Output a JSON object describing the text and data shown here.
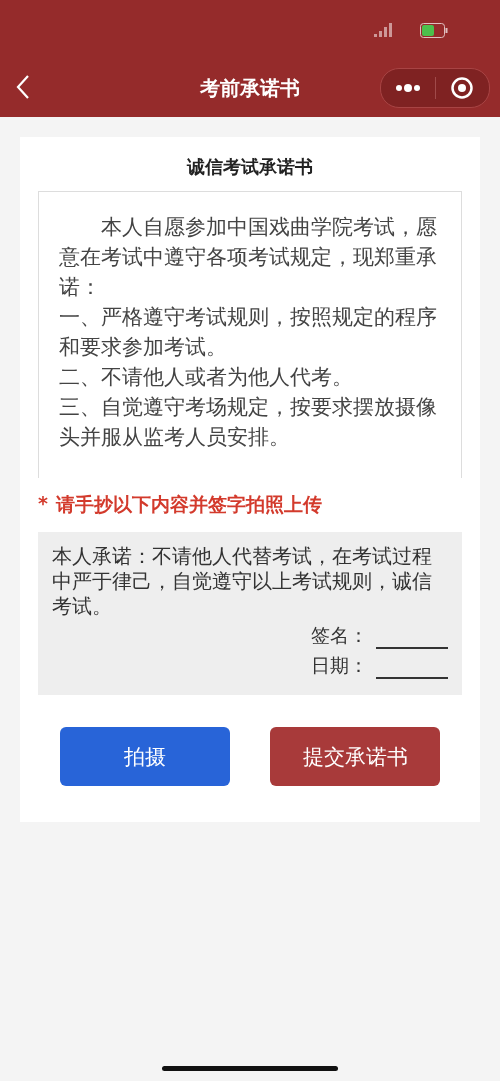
{
  "nav_bar": {
    "title": "考前承诺书"
  },
  "letter": {
    "title": "诚信考试承诺书",
    "paragraphs": [
      {
        "text": "本人自愿参加中国戏曲学院考试，愿意在考试中遵守各项考试规定，现郑重承诺：",
        "indent": true
      },
      {
        "text": "一、严格遵守考试规则，按照规定的程序和要求参加考试。",
        "indent": false
      },
      {
        "text": "二、不请他人或者为他人代考。",
        "indent": false
      },
      {
        "text": "三、自觉遵守考场规定，按要求摆放摄像头并服从监考人员安排。",
        "indent": false
      }
    ]
  },
  "notice": {
    "mark": "*",
    "text": "请手抄以下内容并签字拍照上传"
  },
  "pledge": {
    "text": "本人承诺：不请他人代替考试，在考试过程中严于律己，自觉遵守以上考试规则，诚信考试。",
    "fields": [
      {
        "label": "签名："
      },
      {
        "label": "日期："
      }
    ]
  },
  "buttons": [
    {
      "label": "拍摄",
      "kind": "secondary"
    },
    {
      "label": "提交承诺书",
      "kind": "primary"
    }
  ]
}
